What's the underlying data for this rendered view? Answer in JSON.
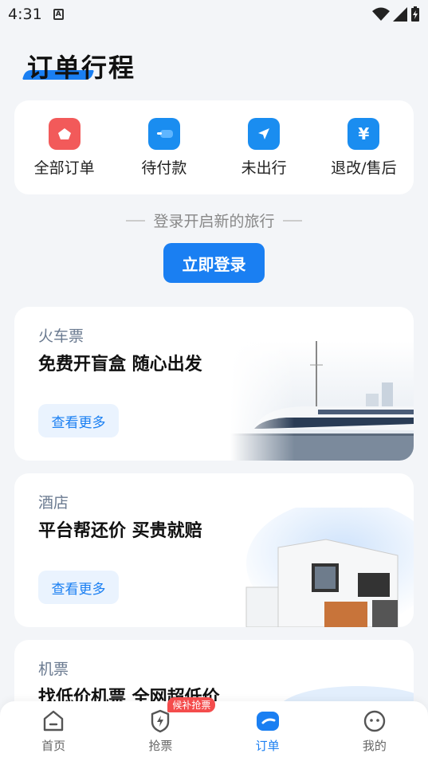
{
  "status_bar": {
    "time": "4:31",
    "a_icon": "A"
  },
  "page": {
    "title": "订单行程"
  },
  "orders": [
    {
      "label": "全部订单",
      "icon": "all-orders-icon",
      "color": "#f25a5a"
    },
    {
      "label": "待付款",
      "icon": "pending-payment-icon",
      "color": "#1a8df0"
    },
    {
      "label": "未出行",
      "icon": "not-traveled-icon",
      "color": "#1a8df0"
    },
    {
      "label": "退改/售后",
      "icon": "refund-icon",
      "color": "#1a8df0",
      "glyph": "¥"
    }
  ],
  "login": {
    "hint": "登录开启新的旅行",
    "button": "立即登录"
  },
  "promos": [
    {
      "tag": "火车票",
      "headline": "免费开盲盒 随心出发",
      "more": "查看更多"
    },
    {
      "tag": "酒店",
      "headline": "平台帮还价 买贵就赔",
      "more": "查看更多"
    },
    {
      "tag": "机票",
      "headline": "找低价机票 全网超低价"
    }
  ],
  "tabs": [
    {
      "label": "首页",
      "icon": "home-icon"
    },
    {
      "label": "抢票",
      "icon": "grab-ticket-icon",
      "badge": "候补抢票"
    },
    {
      "label": "订单",
      "icon": "orders-icon",
      "active": true
    },
    {
      "label": "我的",
      "icon": "profile-icon"
    }
  ],
  "colors": {
    "accent": "#1a7ff2",
    "badge": "#f44c4c"
  }
}
